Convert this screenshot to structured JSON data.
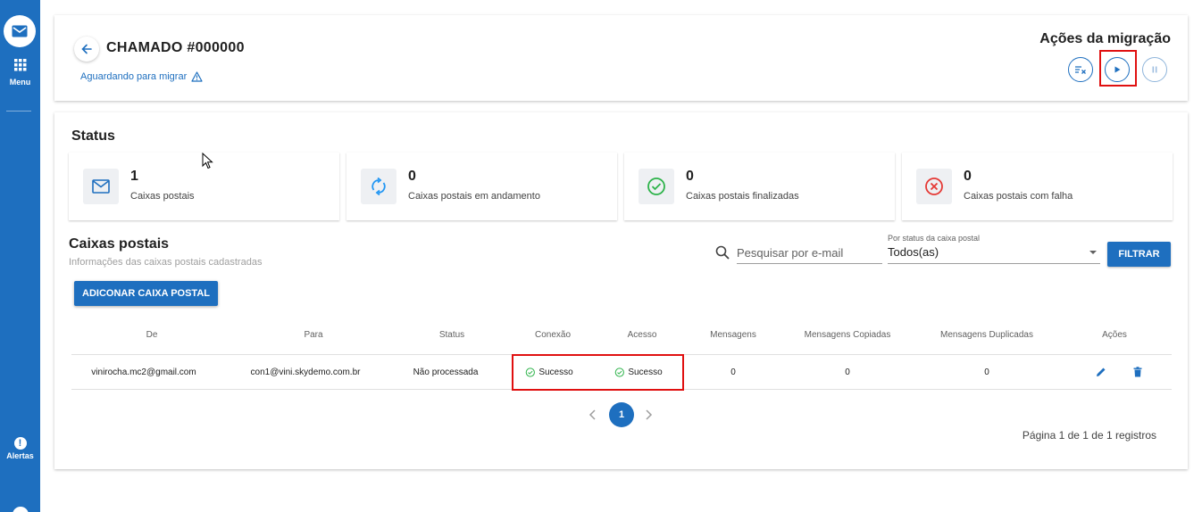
{
  "sidebar": {
    "menu_label": "Menu",
    "alerts_label": "Alertas",
    "alert_glyph": "!"
  },
  "header": {
    "back_icon": "arrow-left-icon",
    "ticket_title": "CHAMADO #000000",
    "ticket_status": "Aguardando para migrar",
    "actions_title": "Ações da migração",
    "actions": [
      {
        "icon": "filter-clear-icon",
        "enabled": true
      },
      {
        "icon": "play-icon",
        "enabled": true,
        "highlighted": true
      },
      {
        "icon": "pause-icon",
        "enabled": false
      }
    ]
  },
  "status": {
    "title": "Status",
    "cards": [
      {
        "value": "1",
        "label": "Caixas postais",
        "icon": "mail-icon",
        "color": "#1e6fbf"
      },
      {
        "value": "0",
        "label": "Caixas postais em andamento",
        "icon": "sync-icon",
        "color": "#2196f3"
      },
      {
        "value": "0",
        "label": "Caixas postais finalizadas",
        "icon": "check-circle-icon",
        "color": "#2db34a"
      },
      {
        "value": "0",
        "label": "Caixas postais com falha",
        "icon": "error-circle-icon",
        "color": "#e53935"
      }
    ]
  },
  "mailboxes": {
    "title": "Caixas postais",
    "subtitle": "Informações das caixas postais cadastradas",
    "search_placeholder": "Pesquisar por e-mail",
    "filter_label": "Por status da caixa postal",
    "filter_value": "Todos(as)",
    "filter_button": "FILTRAR",
    "add_button": "ADICONAR CAIXA POSTAL",
    "columns": [
      "De",
      "Para",
      "Status",
      "Conexão",
      "Acesso",
      "Mensagens",
      "Mensagens Copiadas",
      "Mensagens Duplicadas",
      "Ações"
    ],
    "rows": [
      {
        "de": "vinirocha.mc2@gmail.com",
        "para": "con1@vini.skydemo.com.br",
        "status": "Não processada",
        "conexao": "Sucesso",
        "acesso": "Sucesso",
        "mensagens": "0",
        "copiadas": "0",
        "duplicadas": "0"
      }
    ]
  },
  "pagination": {
    "current": "1",
    "info": "Página 1 de 1 de 1 registros"
  },
  "colors": {
    "primary": "#1e6fbf",
    "success": "#2db34a",
    "error": "#e53935",
    "highlight": "#e01010"
  }
}
